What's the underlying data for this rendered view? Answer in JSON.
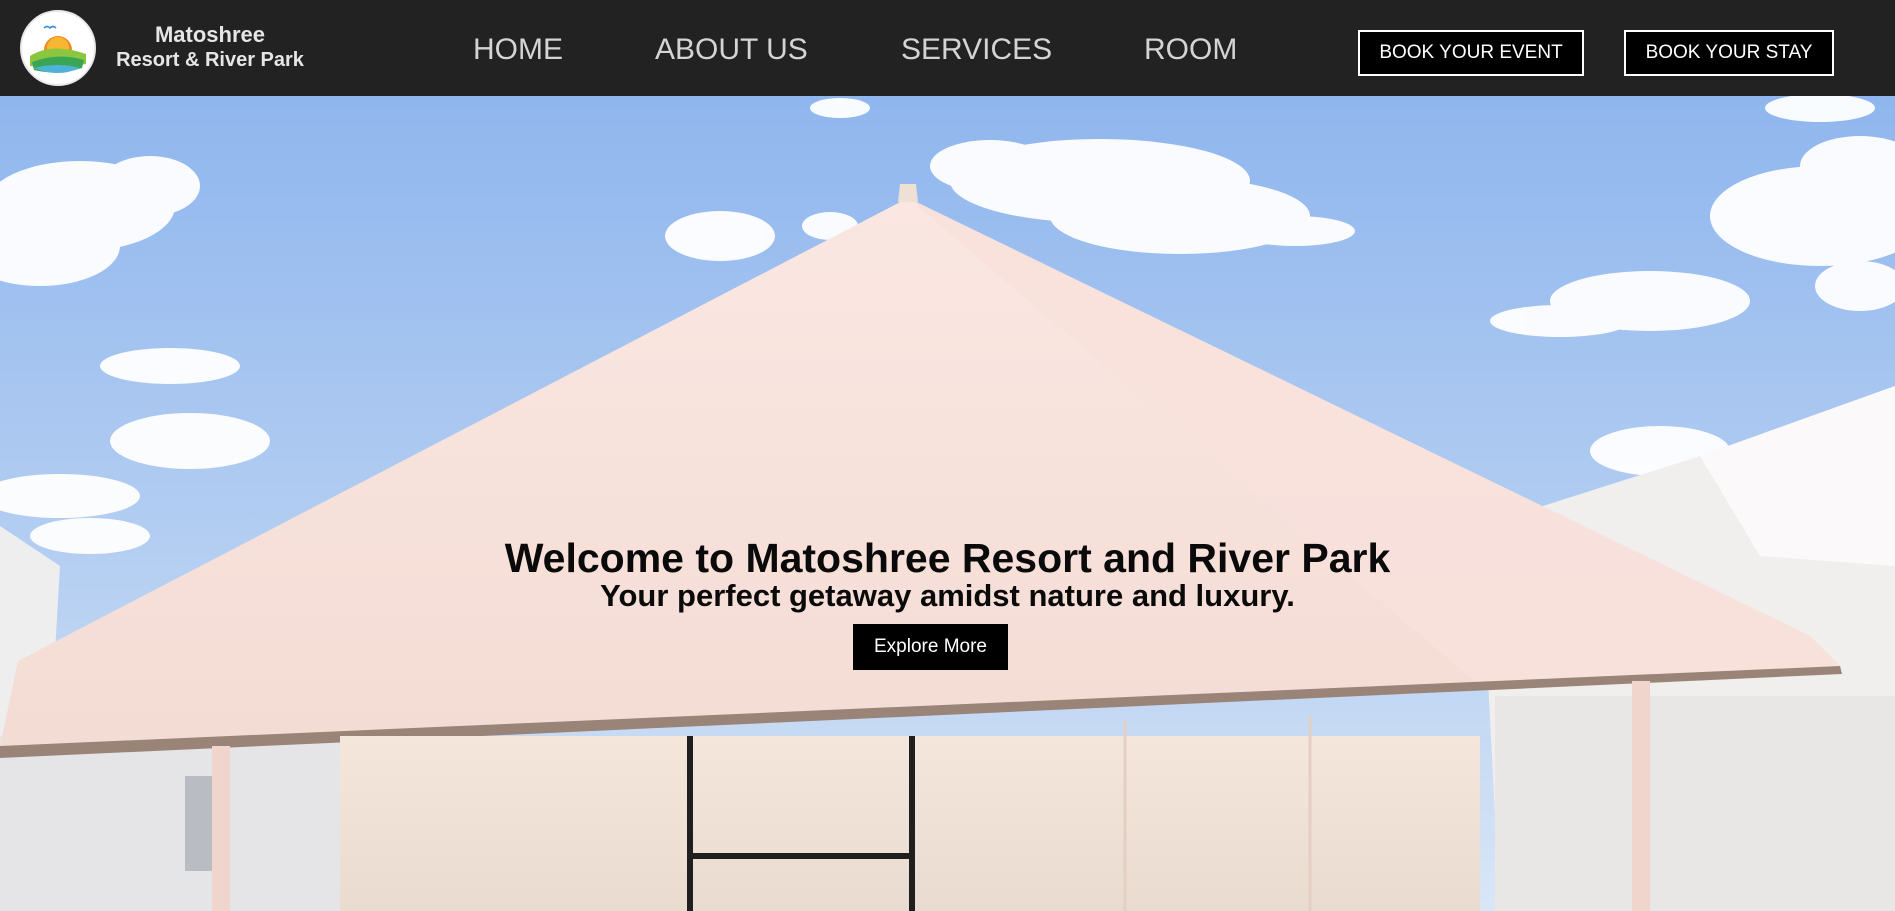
{
  "brand": {
    "name": "Matoshree",
    "subtitle": "Resort & River Park",
    "logo_icon": "sunrise-hills-logo-icon"
  },
  "nav": {
    "items": [
      {
        "label": "HOME"
      },
      {
        "label": "ABOUT US"
      },
      {
        "label": "SERVICES"
      },
      {
        "label": "ROOM"
      }
    ]
  },
  "actions": {
    "book_event_label": "BOOK YOUR EVENT",
    "book_stay_label": "BOOK YOUR STAY"
  },
  "hero": {
    "title": "Welcome to Matoshree Resort and River Park",
    "subtitle": "Your perfect getaway amidst nature and luxury.",
    "button_label": "Explore More",
    "background": "white-tent-under-blue-sky-photo"
  },
  "colors": {
    "header_bg": "#222222",
    "nav_text": "#d4d4d4",
    "button_bg": "#000000",
    "button_text": "#ffffff",
    "sky": "#9fc3f2",
    "tent": "#f6e4df"
  }
}
